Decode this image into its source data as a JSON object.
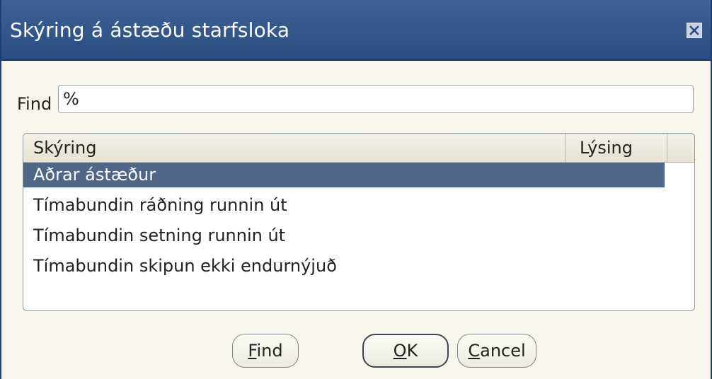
{
  "window": {
    "title": "Skýring á ástæðu starfsloka",
    "close_icon": "close-icon"
  },
  "search": {
    "label": "Find",
    "value": "%"
  },
  "list": {
    "columns": [
      "Skýring",
      "Lýsing"
    ],
    "rows": [
      {
        "label": "Aðrar ástæður",
        "selected": true
      },
      {
        "label": "Tímabundin ráðning runnin út",
        "selected": false
      },
      {
        "label": "Tímabundin setning runnin út",
        "selected": false
      },
      {
        "label": "Tímabundin skipun ekki endurnýjuð",
        "selected": false
      }
    ]
  },
  "buttons": {
    "find": {
      "mnemonic": "F",
      "rest": "ind"
    },
    "ok": {
      "mnemonic": "O",
      "rest": "K"
    },
    "cancel": {
      "mnemonic": "C",
      "rest": "ancel"
    }
  },
  "colors": {
    "titlebar": "#2a4d82",
    "selection": "#4e6688",
    "background": "#f7f5ec"
  }
}
